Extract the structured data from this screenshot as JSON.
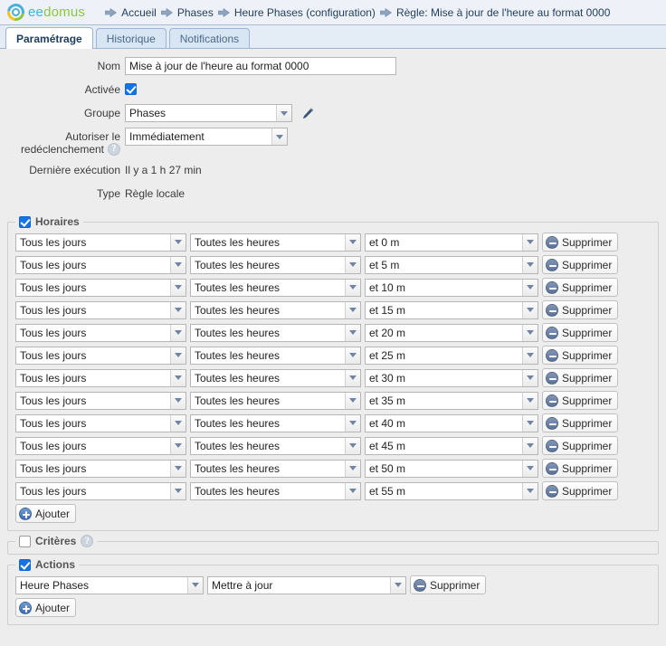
{
  "header": {
    "logo_text_blue": "ee",
    "logo_text_green": "domus",
    "logo_icon": "eedomus-ring-logo",
    "breadcrumb": [
      {
        "label": "Accueil",
        "icon": "arrow-right-icon"
      },
      {
        "label": "Phases",
        "icon": "arrow-right-icon"
      },
      {
        "label": "Heure Phases (configuration)",
        "icon": "arrow-right-icon"
      },
      {
        "label": "Règle: Mise à jour de l'heure au format 0000",
        "icon": "arrow-right-icon"
      }
    ]
  },
  "tabs": [
    {
      "label": "Paramétrage",
      "active": true
    },
    {
      "label": "Historique",
      "active": false
    },
    {
      "label": "Notifications",
      "active": false
    }
  ],
  "form": {
    "name_label": "Nom",
    "name_value": "Mise à jour de l'heure au format 0000",
    "name_placeholder": "",
    "enabled_label": "Activée",
    "enabled_checked": true,
    "group_label": "Groupe",
    "group_value": "Phases",
    "group_edit_icon": "pencil-icon",
    "retrigger_label": "Autoriser le redéclenchement",
    "retrigger_label_line1": "Autoriser le",
    "retrigger_label_line2": "redéclenchement",
    "retrigger_value": "Immédiatement",
    "retrigger_help_icon": "help-icon",
    "retrigger_help_glyph": "?",
    "last_exec_label": "Dernière exécution",
    "last_exec_value": "Il y a 1 h 27 min",
    "type_label": "Type",
    "type_value": "Règle locale"
  },
  "schedules": {
    "legend": "Horaires",
    "checked": true,
    "add_label": "Ajouter",
    "add_icon": "plus-circle-icon",
    "delete_label": "Supprimer",
    "delete_icon": "minus-circle-icon",
    "rows": [
      {
        "day": "Tous les jours",
        "hour": "Toutes les heures",
        "minute": "et 0 m"
      },
      {
        "day": "Tous les jours",
        "hour": "Toutes les heures",
        "minute": "et 5 m"
      },
      {
        "day": "Tous les jours",
        "hour": "Toutes les heures",
        "minute": "et 10 m"
      },
      {
        "day": "Tous les jours",
        "hour": "Toutes les heures",
        "minute": "et 15 m"
      },
      {
        "day": "Tous les jours",
        "hour": "Toutes les heures",
        "minute": "et 20 m"
      },
      {
        "day": "Tous les jours",
        "hour": "Toutes les heures",
        "minute": "et 25 m"
      },
      {
        "day": "Tous les jours",
        "hour": "Toutes les heures",
        "minute": "et 30 m"
      },
      {
        "day": "Tous les jours",
        "hour": "Toutes les heures",
        "minute": "et 35 m"
      },
      {
        "day": "Tous les jours",
        "hour": "Toutes les heures",
        "minute": "et 40 m"
      },
      {
        "day": "Tous les jours",
        "hour": "Toutes les heures",
        "minute": "et 45 m"
      },
      {
        "day": "Tous les jours",
        "hour": "Toutes les heures",
        "minute": "et 50 m"
      },
      {
        "day": "Tous les jours",
        "hour": "Toutes les heures",
        "minute": "et 55 m"
      }
    ]
  },
  "criteria": {
    "legend": "Critères",
    "checked": false,
    "help_icon": "help-icon",
    "help_glyph": "?"
  },
  "actions": {
    "legend": "Actions",
    "checked": true,
    "add_label": "Ajouter",
    "add_icon": "plus-circle-icon",
    "delete_label": "Supprimer",
    "delete_icon": "minus-circle-icon",
    "rows": [
      {
        "target": "Heure Phases",
        "operation": "Mettre à jour"
      }
    ]
  },
  "colors": {
    "accent_blue": "#1673e6",
    "logo_green": "#8cc63f",
    "logo_blue": "#49b0d7",
    "page_bg": "#ededed",
    "header_bg": "#eef2f8"
  }
}
